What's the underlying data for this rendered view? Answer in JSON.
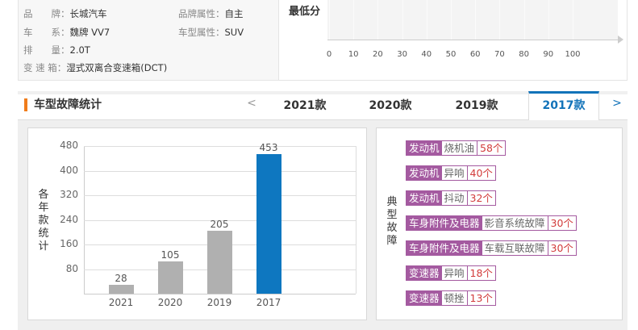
{
  "info": {
    "rows": [
      {
        "k1": "品　　牌：",
        "v1": "长城汽车",
        "k2": "品牌属性：",
        "v2": "自主"
      },
      {
        "k1": "车　　系：",
        "v1": "魏牌 VV7",
        "k2": "车型属性：",
        "v2": "SUV"
      },
      {
        "k1": "排　　量：",
        "v1": "2.0T"
      },
      {
        "k1": "变 速 箱：",
        "v1": "湿式双离合变速箱(DCT)"
      }
    ]
  },
  "score": {
    "label": "最低分",
    "value": "0",
    "ticks": [
      "0",
      "10",
      "20",
      "30",
      "40",
      "50",
      "60",
      "70",
      "80",
      "90",
      "100"
    ]
  },
  "section": {
    "title": "车型故障统计",
    "prev": "<",
    "next": ">",
    "tabs": [
      "2021款",
      "2020款",
      "2019款",
      "2017款"
    ],
    "active": "2017款"
  },
  "chart_data": {
    "type": "bar",
    "categories": [
      "2021",
      "2020",
      "2019",
      "2017"
    ],
    "values": [
      28,
      105,
      205,
      453
    ],
    "ylabel": "各年款统计",
    "yticks": [
      80,
      160,
      240,
      320,
      400,
      480
    ],
    "ylim": [
      0,
      480
    ],
    "colors": [
      "#b0b0b0",
      "#b0b0b0",
      "#b0b0b0",
      "#0e77c0"
    ]
  },
  "faults": {
    "label": "典型故障",
    "items": [
      {
        "cat": "发动机",
        "issue": "烧机油",
        "count": "58个"
      },
      {
        "cat": "发动机",
        "issue": "异响",
        "count": "40个"
      },
      {
        "cat": "发动机",
        "issue": "抖动",
        "count": "32个"
      },
      {
        "cat": "车身附件及电器",
        "issue": "影音系统故障",
        "count": "30个"
      },
      {
        "cat": "车身附件及电器",
        "issue": "车载互联故障",
        "count": "30个"
      },
      {
        "cat": "变速器",
        "issue": "异响",
        "count": "18个"
      },
      {
        "cat": "变速器",
        "issue": "顿挫",
        "count": "13个"
      }
    ]
  }
}
